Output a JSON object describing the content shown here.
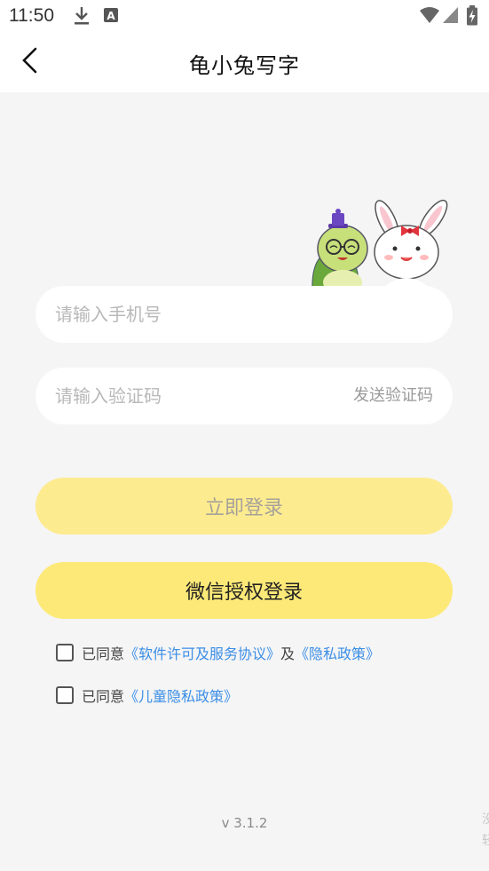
{
  "status_bar": {
    "time": "11:50",
    "icons": [
      "download-icon",
      "a-notification-icon",
      "wifi-icon",
      "signal-icon",
      "battery-charging-icon"
    ]
  },
  "app_bar": {
    "title": "龟小兔写字",
    "back_icon": "chevron-left-icon"
  },
  "form": {
    "phone_placeholder": "请输入手机号",
    "code_placeholder": "请输入验证码",
    "send_code_label": "发送验证码",
    "login_label": "立即登录",
    "wechat_label": "微信授权登录"
  },
  "agreements": [
    {
      "prefix": "已同意",
      "link1": "《软件许可及服务协议》",
      "joiner": "及",
      "link2": "《隐私政策》"
    },
    {
      "prefix": "已同意",
      "link1": "《儿童隐私政策》"
    }
  ],
  "footer": {
    "version": "v 3.1.2",
    "edge_text_1": "没",
    "edge_text_2": "轻"
  },
  "colors": {
    "accent_yellow": "#fde978",
    "disabled_yellow": "#fdeb8f",
    "link_blue": "#3b8ee6",
    "background": "#f5f5f5"
  }
}
